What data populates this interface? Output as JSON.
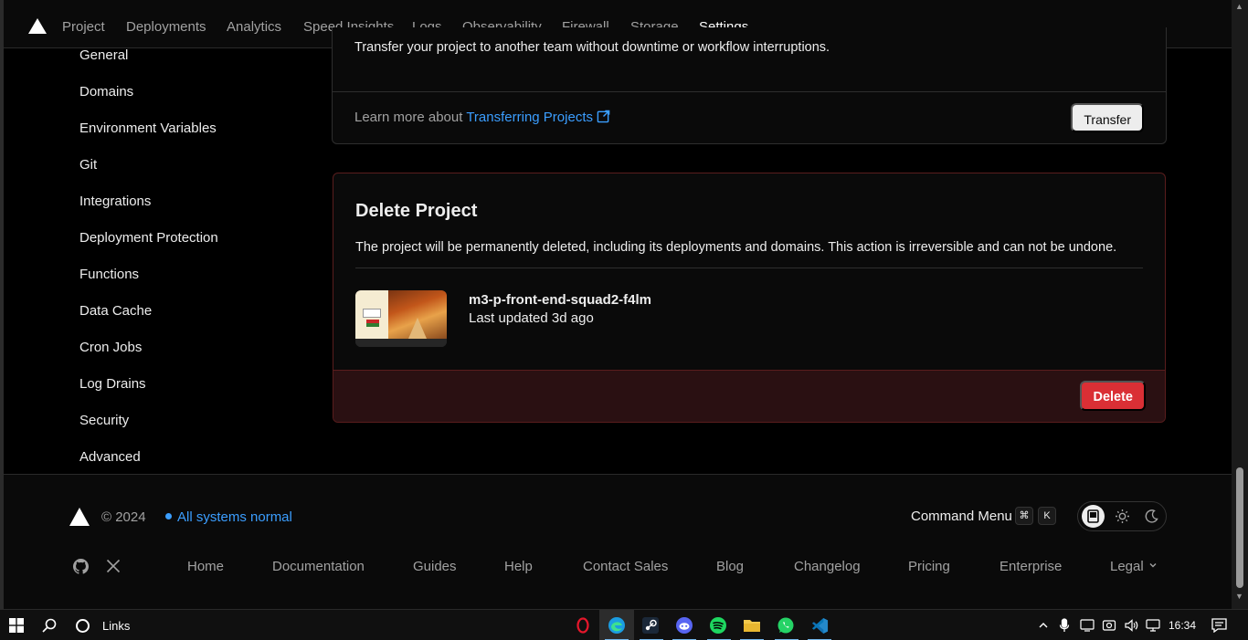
{
  "nav": {
    "tabs": [
      "Project",
      "Deployments",
      "Analytics",
      "Speed Insights",
      "Logs",
      "Observability",
      "Firewall",
      "Storage",
      "Settings"
    ],
    "active_tab": "Settings"
  },
  "sidebar": {
    "items": [
      "General",
      "Domains",
      "Environment Variables",
      "Git",
      "Integrations",
      "Deployment Protection",
      "Functions",
      "Data Cache",
      "Cron Jobs",
      "Log Drains",
      "Security",
      "Advanced"
    ]
  },
  "transfer": {
    "cut_text": "Transfer your project to another team without downtime or workflow interruptions.",
    "learn_prefix": "Learn more about",
    "learn_link": "Transferring Projects",
    "button": "Transfer"
  },
  "delete": {
    "title": "Delete Project",
    "description": "The project will be permanently deleted, including its deployments and domains. This action is irreversible and can not be undone.",
    "project_name": "m3-p-front-end-squad2-f4lm",
    "last_updated": "Last updated 3d ago",
    "button": "Delete"
  },
  "footer": {
    "copyright": "© 2024",
    "status": "All systems normal",
    "command_menu": "Command Menu",
    "kbd_cmd": "⌘",
    "kbd_k": "K",
    "links": [
      "Home",
      "Documentation",
      "Guides",
      "Help",
      "Contact Sales",
      "Blog",
      "Changelog",
      "Pricing",
      "Enterprise",
      "Legal"
    ]
  },
  "taskbar": {
    "search_label": "Links",
    "time": "16:34"
  },
  "colors": {
    "accent_link": "#3b9eff",
    "danger": "#da2f35",
    "danger_border": "#5a1d1d"
  }
}
